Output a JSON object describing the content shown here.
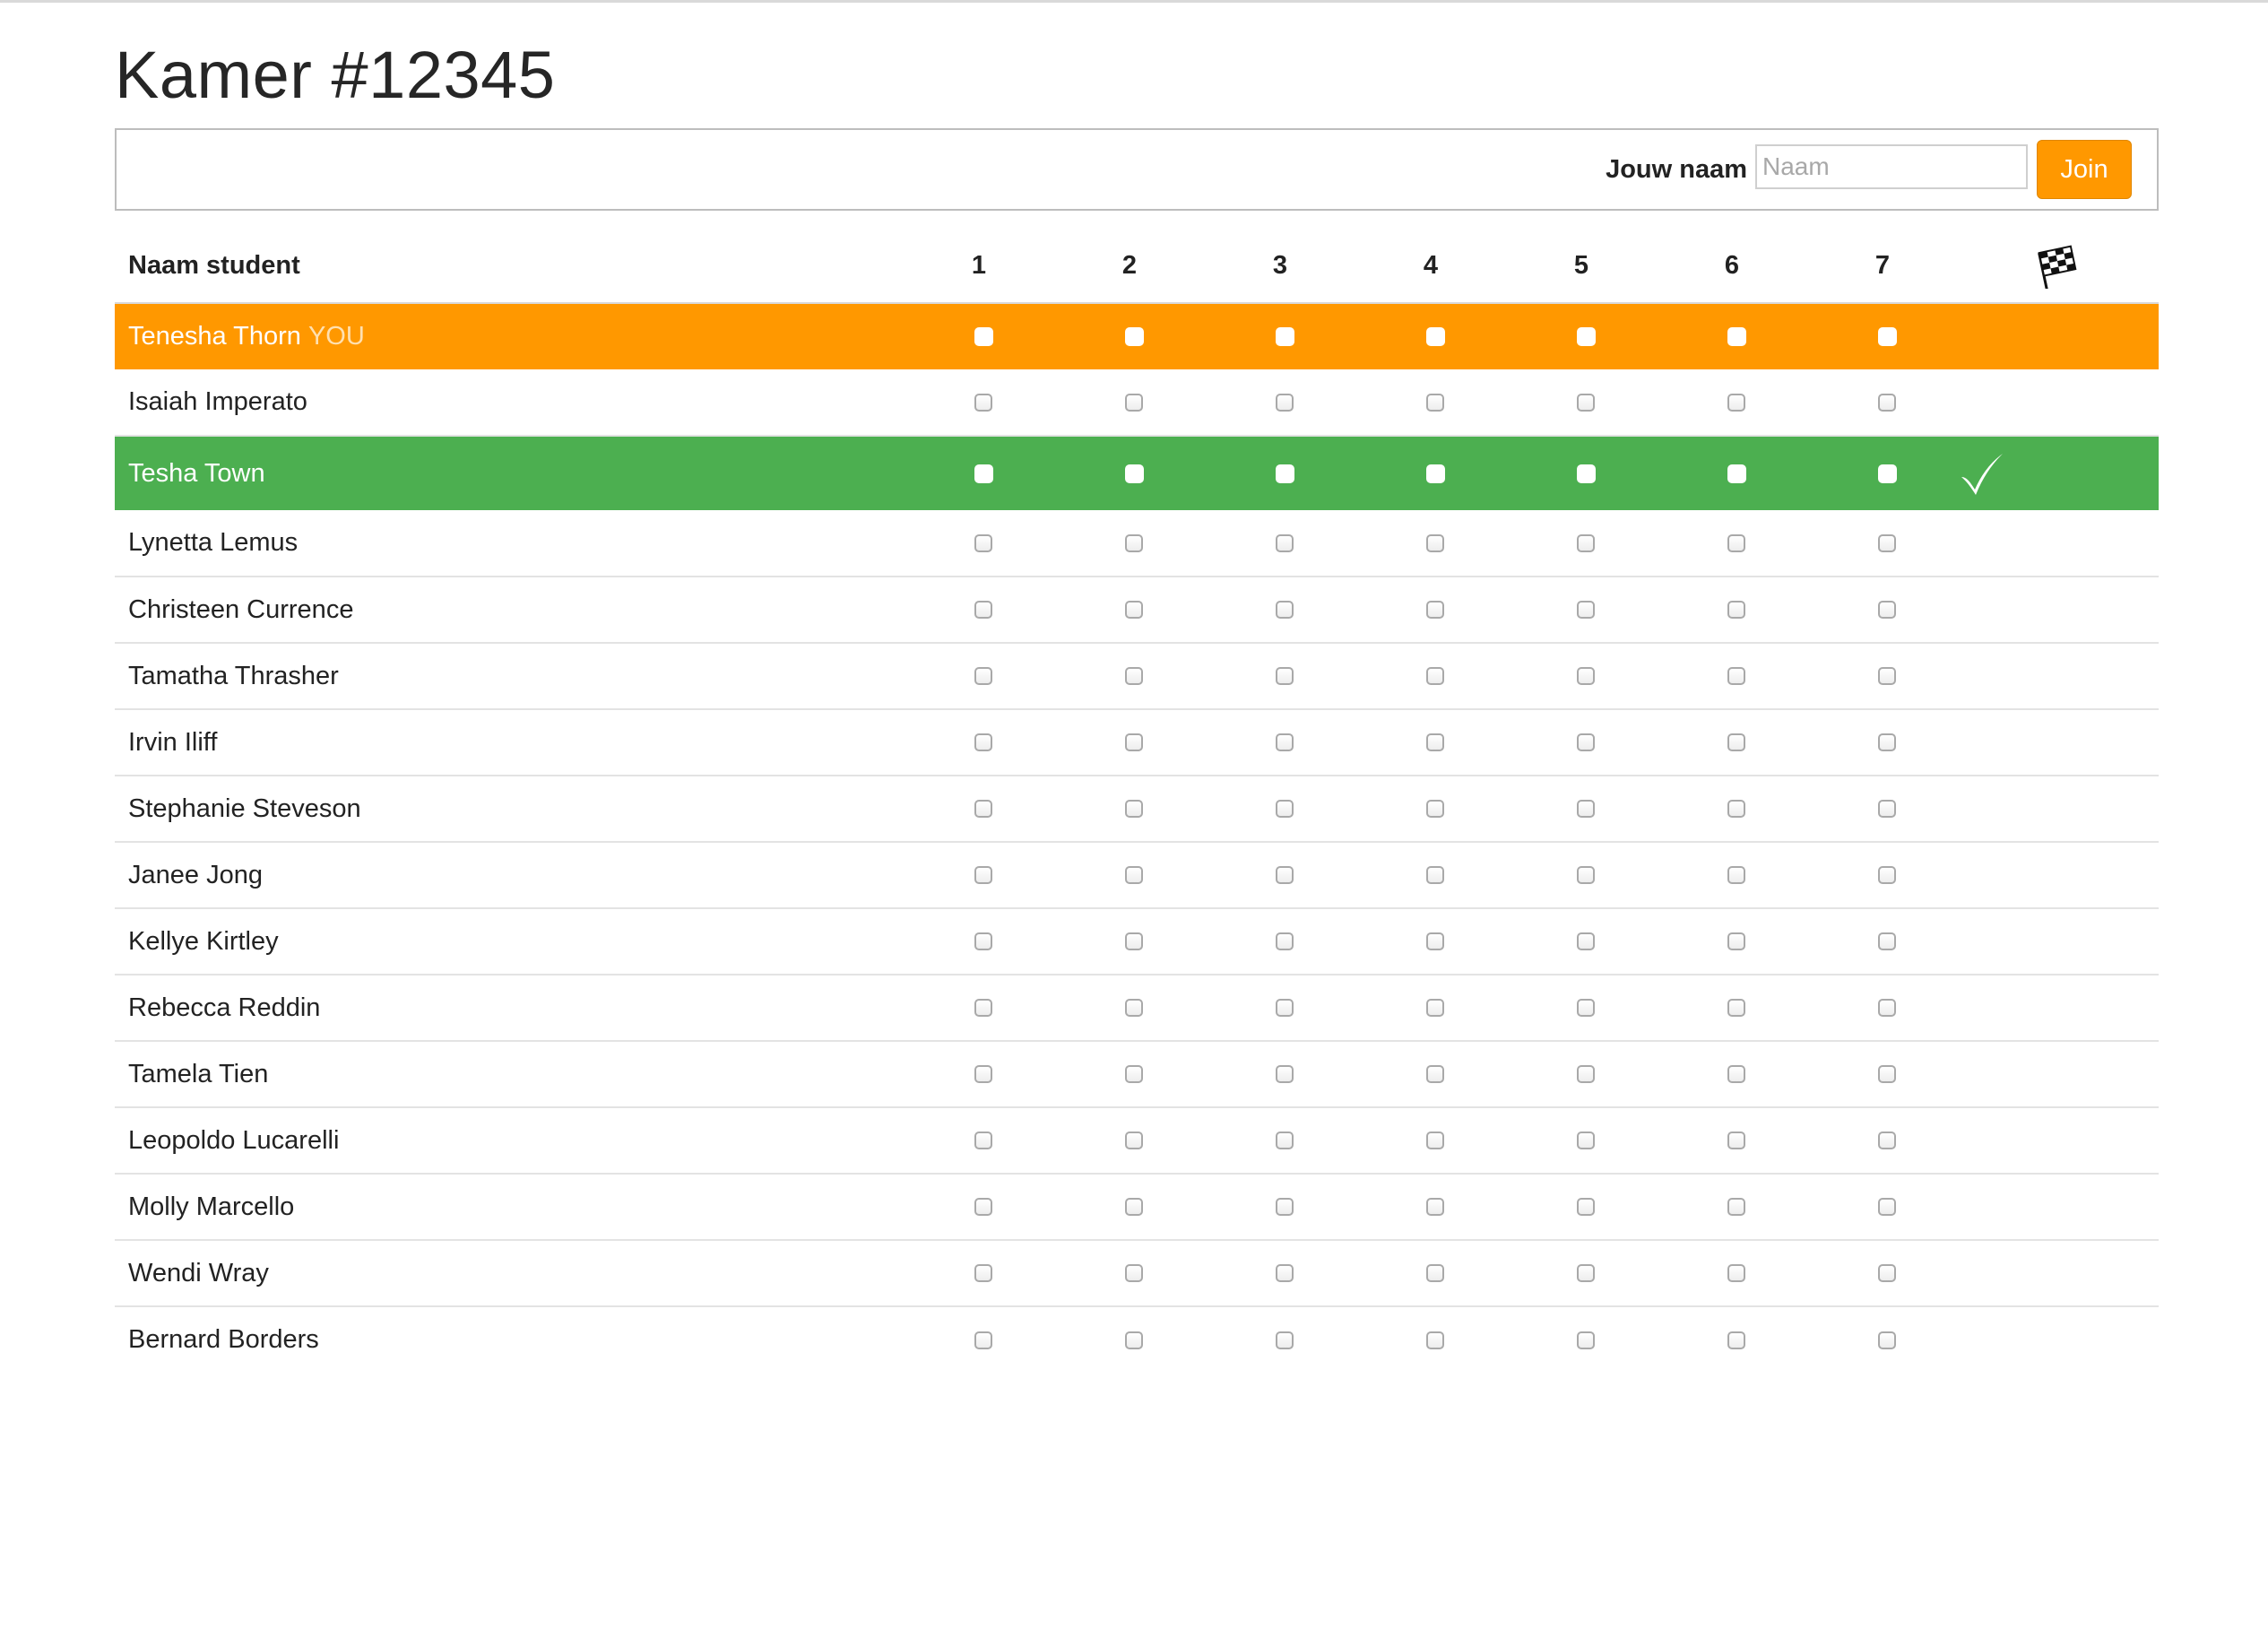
{
  "page": {
    "title": "Kamer #12345"
  },
  "join": {
    "label": "Jouw naam",
    "placeholder": "Naam",
    "value": "",
    "button_label": "Join"
  },
  "table": {
    "name_header": "Naam student",
    "step_headers": [
      "1",
      "2",
      "3",
      "4",
      "5",
      "6",
      "7"
    ],
    "finish_icon": "checkered-flag-icon",
    "you_tag": "YOU",
    "rows": [
      {
        "name": "Tenesha Thorn",
        "is_you": true,
        "finished": false,
        "highlight": "#ff9800",
        "steps": [
          false,
          false,
          false,
          false,
          false,
          false,
          false
        ]
      },
      {
        "name": "Isaiah Imperato",
        "is_you": false,
        "finished": false,
        "highlight": null,
        "steps": [
          false,
          false,
          false,
          false,
          false,
          false,
          false
        ]
      },
      {
        "name": "Tesha Town",
        "is_you": false,
        "finished": true,
        "highlight": "#4caf50",
        "steps": [
          false,
          false,
          false,
          false,
          false,
          false,
          false
        ]
      },
      {
        "name": "Lynetta Lemus",
        "is_you": false,
        "finished": false,
        "highlight": null,
        "steps": [
          false,
          false,
          false,
          false,
          false,
          false,
          false
        ]
      },
      {
        "name": "Christeen Currence",
        "is_you": false,
        "finished": false,
        "highlight": null,
        "steps": [
          false,
          false,
          false,
          false,
          false,
          false,
          false
        ]
      },
      {
        "name": "Tamatha Thrasher",
        "is_you": false,
        "finished": false,
        "highlight": null,
        "steps": [
          false,
          false,
          false,
          false,
          false,
          false,
          false
        ]
      },
      {
        "name": "Irvin Iliff",
        "is_you": false,
        "finished": false,
        "highlight": null,
        "steps": [
          false,
          false,
          false,
          false,
          false,
          false,
          false
        ]
      },
      {
        "name": "Stephanie Steveson",
        "is_you": false,
        "finished": false,
        "highlight": null,
        "steps": [
          false,
          false,
          false,
          false,
          false,
          false,
          false
        ]
      },
      {
        "name": "Janee Jong",
        "is_you": false,
        "finished": false,
        "highlight": null,
        "steps": [
          false,
          false,
          false,
          false,
          false,
          false,
          false
        ]
      },
      {
        "name": "Kellye Kirtley",
        "is_you": false,
        "finished": false,
        "highlight": null,
        "steps": [
          false,
          false,
          false,
          false,
          false,
          false,
          false
        ]
      },
      {
        "name": "Rebecca Reddin",
        "is_you": false,
        "finished": false,
        "highlight": null,
        "steps": [
          false,
          false,
          false,
          false,
          false,
          false,
          false
        ]
      },
      {
        "name": "Tamela Tien",
        "is_you": false,
        "finished": false,
        "highlight": null,
        "steps": [
          false,
          false,
          false,
          false,
          false,
          false,
          false
        ]
      },
      {
        "name": "Leopoldo Lucarelli",
        "is_you": false,
        "finished": false,
        "highlight": null,
        "steps": [
          false,
          false,
          false,
          false,
          false,
          false,
          false
        ]
      },
      {
        "name": "Molly Marcello",
        "is_you": false,
        "finished": false,
        "highlight": null,
        "steps": [
          false,
          false,
          false,
          false,
          false,
          false,
          false
        ]
      },
      {
        "name": "Wendi Wray",
        "is_you": false,
        "finished": false,
        "highlight": null,
        "steps": [
          false,
          false,
          false,
          false,
          false,
          false,
          false
        ]
      },
      {
        "name": "Bernard Borders",
        "is_you": false,
        "finished": false,
        "highlight": null,
        "steps": [
          false,
          false,
          false,
          false,
          false,
          false,
          false
        ]
      }
    ]
  },
  "colors": {
    "accent_orange": "#ff9800",
    "finished_green": "#4caf50",
    "text": "#222222"
  }
}
